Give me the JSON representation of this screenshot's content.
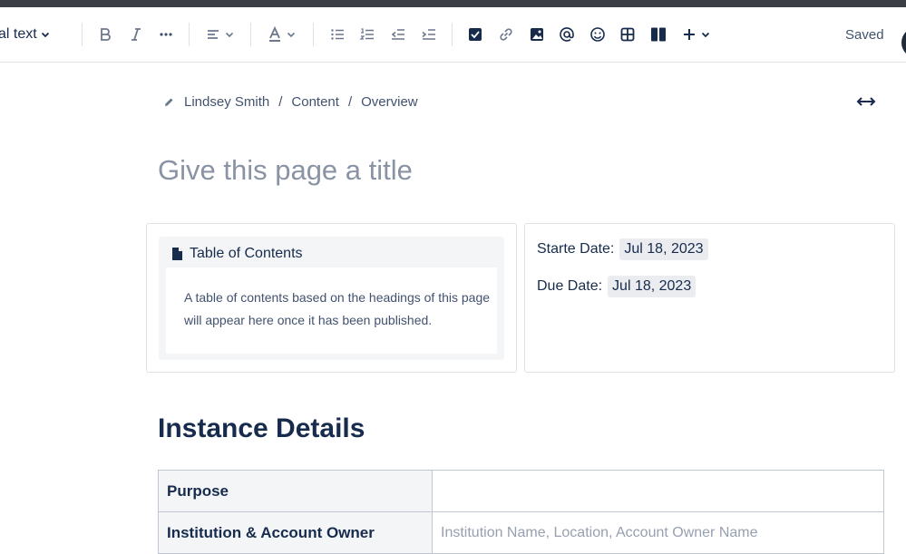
{
  "toolbar": {
    "text_style": "al text",
    "saved": "Saved"
  },
  "breadcrumb": {
    "items": [
      "Lindsey Smith",
      "Content",
      "Overview"
    ],
    "separator": "/"
  },
  "page": {
    "title_placeholder": "Give this page a title"
  },
  "toc": {
    "title": "Table of Contents",
    "body": "A table of contents based on the headings of this page will appear here once it has been published."
  },
  "dates": {
    "start_label": "Starte Date:",
    "start_value": "Jul 18, 2023",
    "due_label": "Due Date:",
    "due_value": "Jul 18, 2023"
  },
  "section": {
    "heading": "Instance Details"
  },
  "details_table": {
    "rows": [
      {
        "key": "Purpose",
        "value": ""
      },
      {
        "key": "Institution & Account Owner",
        "value": "Institution Name, Location, Account Owner Name"
      }
    ]
  },
  "colors": {
    "text": "#172b4d",
    "muted": "#42526e",
    "placeholder": "#8993a4",
    "border": "#dfe1e6"
  }
}
